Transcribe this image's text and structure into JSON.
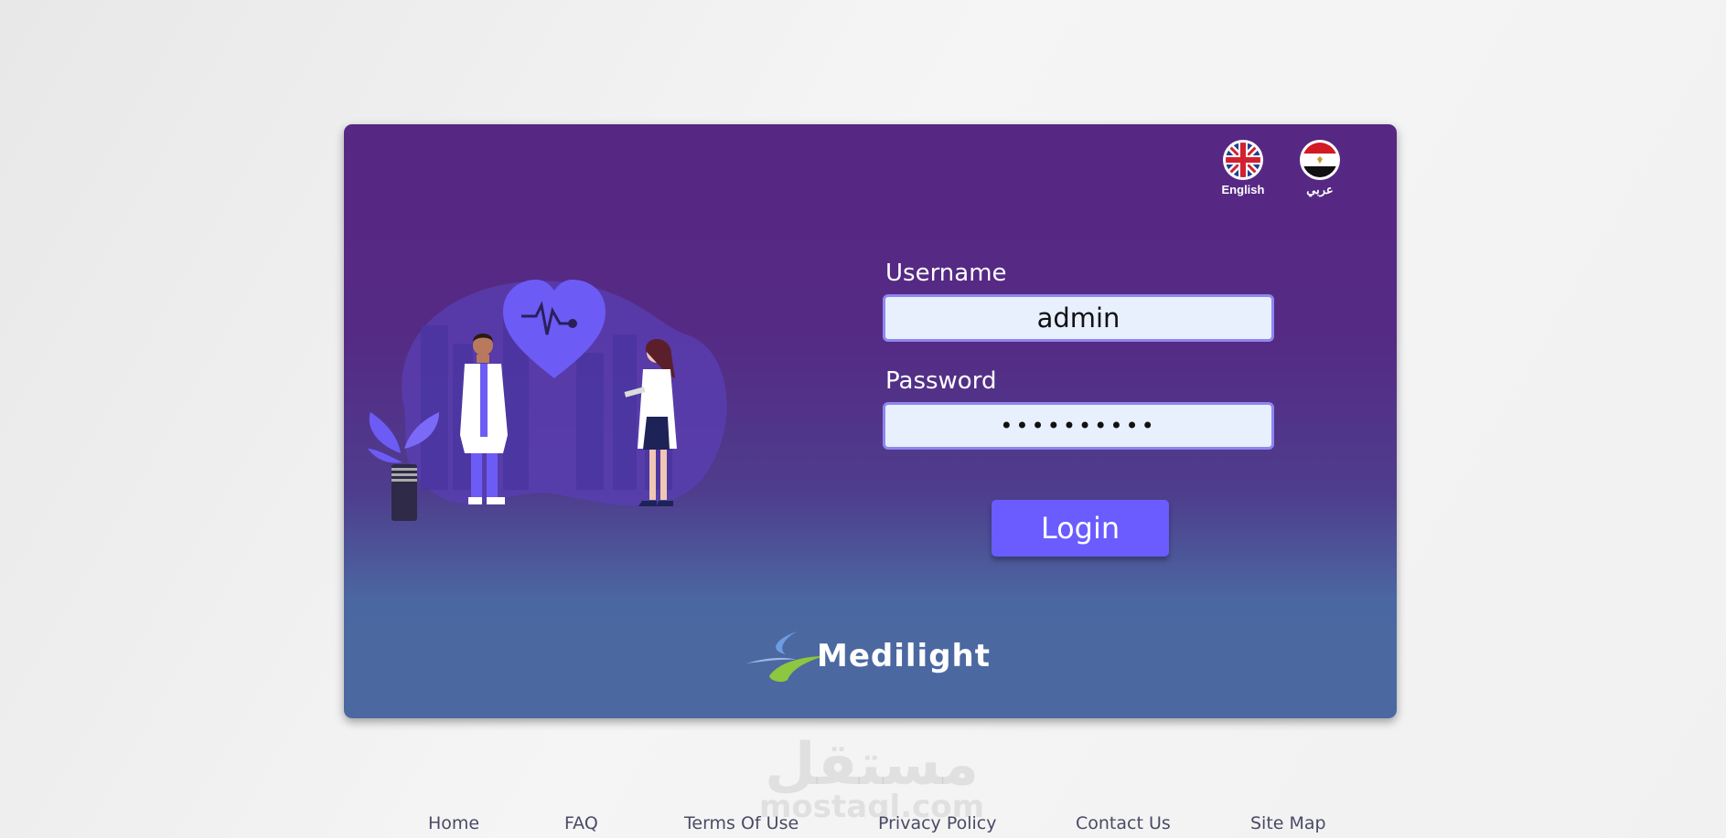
{
  "languages": [
    {
      "label": "English",
      "icon": "uk-flag-icon"
    },
    {
      "label": "عربي",
      "icon": "egypt-flag-icon"
    }
  ],
  "form": {
    "username_label": "Username",
    "username_value": "admin",
    "password_label": "Password",
    "password_value": "••••••••••",
    "login_label": "Login"
  },
  "brand": {
    "name": "Medilight"
  },
  "watermark": {
    "arabic": "مستقل",
    "latin": "mostaql.com"
  },
  "footer": {
    "links": [
      "Home",
      "FAQ",
      "Terms Of Use",
      "Privacy Policy",
      "Contact Us",
      "Site Map"
    ]
  },
  "colors": {
    "card_top": "#562783",
    "card_bottom": "#4b69a0",
    "accent": "#6a5cff",
    "input_bg": "#e8f0fe"
  }
}
